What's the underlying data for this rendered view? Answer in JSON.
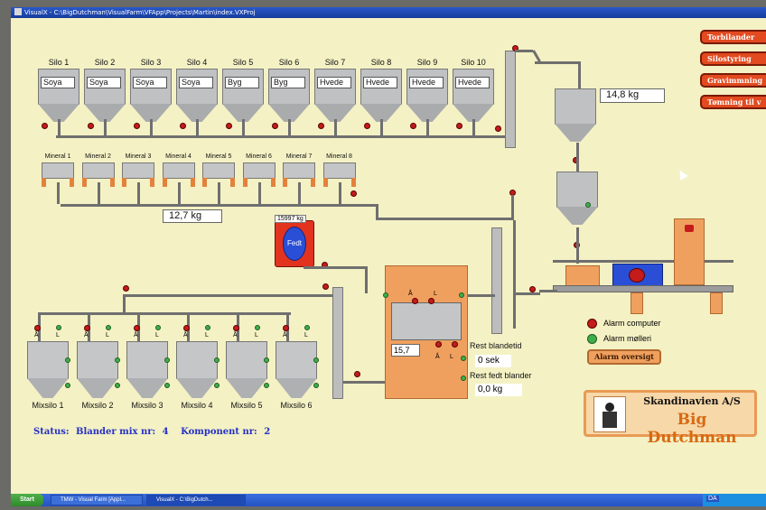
{
  "window": {
    "title": "VisualX - C:\\BigDutchman\\VisualFarm\\VFApp\\Projects\\Martin\\index.VXProj"
  },
  "silos": [
    {
      "name": "Silo 1",
      "content": "Soya"
    },
    {
      "name": "Silo 2",
      "content": "Soya"
    },
    {
      "name": "Silo 3",
      "content": "Soya"
    },
    {
      "name": "Silo 4",
      "content": "Soya"
    },
    {
      "name": "Silo 5",
      "content": "Byg"
    },
    {
      "name": "Silo 6",
      "content": "Byg"
    },
    {
      "name": "Silo 7",
      "content": "Hvede"
    },
    {
      "name": "Silo 8",
      "content": "Hvede"
    },
    {
      "name": "Silo 9",
      "content": "Hvede"
    },
    {
      "name": "Silo 10",
      "content": "Hvede"
    }
  ],
  "minerals": [
    "Mineral 1",
    "Mineral 2",
    "Mineral 3",
    "Mineral 4",
    "Mineral 5",
    "Mineral 6",
    "Mineral 7",
    "Mineral 8"
  ],
  "readouts": {
    "scale_weight": "14,8 kg",
    "mineral_weight": "12,7 kg",
    "fat_tank_value": "15997 kg",
    "fat_tank_label": "Fedt",
    "mixer_level": "15,7",
    "rest_mix_time_label": "Rest blandetid",
    "rest_mix_time": "0 sek",
    "rest_fat_label": "Rest fedt blander",
    "rest_fat": "0,0 kg"
  },
  "mixer_labels": {
    "a": "Å",
    "l": "L"
  },
  "mixsilos": [
    "Mixsilo 1",
    "Mixsilo 2",
    "Mixsilo 3",
    "Mixsilo 4",
    "Mixsilo 5",
    "Mixsilo 6"
  ],
  "legend": {
    "alarm_computer": "Alarm computer",
    "alarm_moelleri": "Alarm mølleri",
    "alarm_overview": "Alarm oversigt"
  },
  "side_buttons": [
    "Torbilander",
    "Silostyring",
    "Gravimmning",
    "Tømning til v"
  ],
  "status": {
    "label": "Status:",
    "mixer_text": "Blander mix nr:",
    "mixer_no": "4",
    "component_text": "Komponent nr:",
    "component_no": "2"
  },
  "logo": {
    "company": "Skandinavien A/S",
    "brand": "Big Dutchman"
  },
  "taskbar": {
    "start": "Start",
    "tasks": [
      "TMW - Visual Farm [Appl...",
      "VisualX - C:\\BigDutch..."
    ],
    "tray_text": "DA"
  },
  "colors": {
    "screen_bg": "#f4f1c4",
    "valve_red": "#c41b1b",
    "valve_green": "#3fae4a",
    "orange": "#f0a05e",
    "button_red": "#e24a1f"
  }
}
